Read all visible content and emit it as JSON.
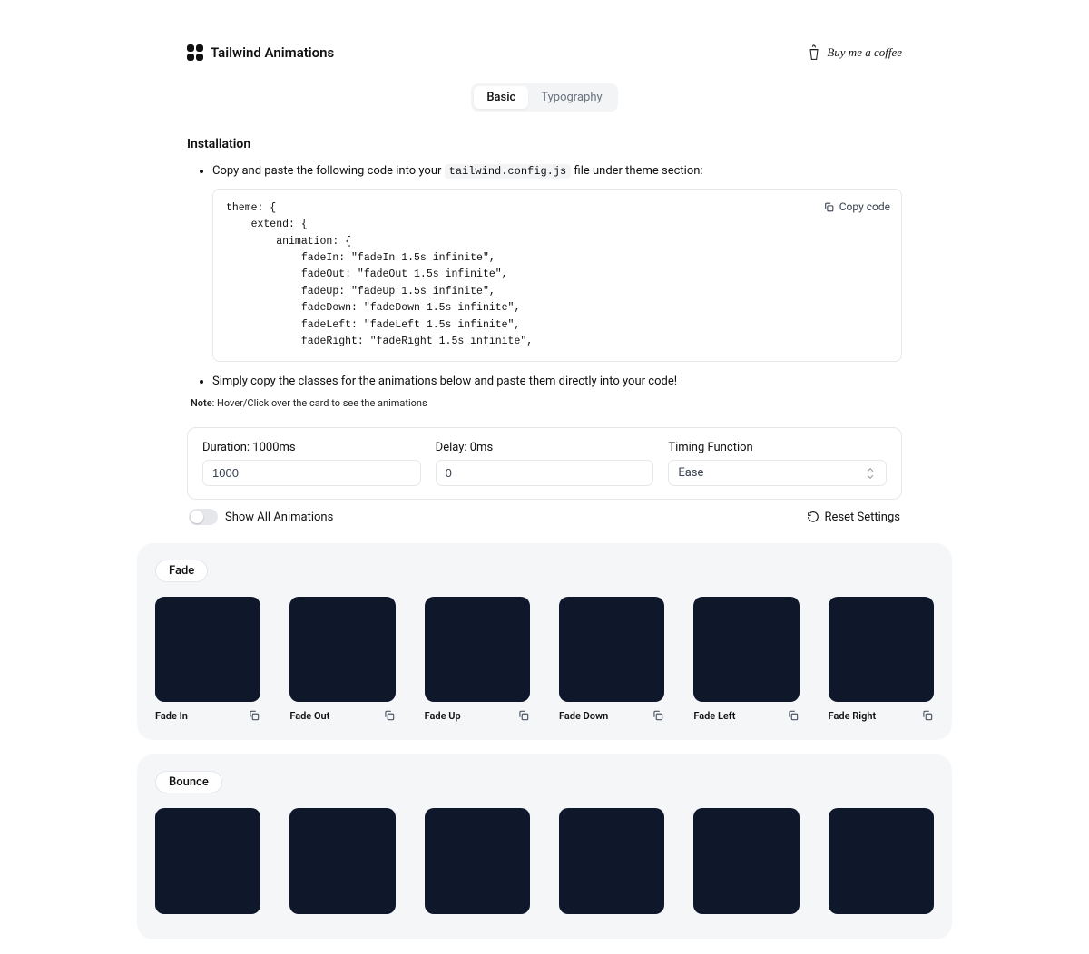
{
  "header": {
    "title": "Tailwind Animations",
    "coffee": "Buy me a coffee"
  },
  "tabs": {
    "basic": "Basic",
    "typography": "Typography"
  },
  "installation": {
    "title": "Installation",
    "step1a": "Copy and paste the following code into your ",
    "step1code": "tailwind.config.js",
    "step1b": " file under theme section:",
    "code": "theme: {\n    extend: {\n        animation: {\n            fadeIn: \"fadeIn 1.5s infinite\",\n            fadeOut: \"fadeOut 1.5s infinite\",\n            fadeUp: \"fadeUp 1.5s infinite\",\n            fadeDown: \"fadeDown 1.5s infinite\",\n            fadeLeft: \"fadeLeft 1.5s infinite\",\n            fadeRight: \"fadeRight 1.5s infinite\",",
    "copy_code": "Copy code",
    "step2": "Simply copy the classes for the animations below and paste them directly into your code!",
    "note_label": "Note",
    "note_text": ": Hover/Click over the card to see the animations"
  },
  "controls": {
    "duration_label": "Duration: 1000ms",
    "duration_value": "1000",
    "delay_label": "Delay: 0ms",
    "delay_value": "0",
    "timing_label": "Timing Function",
    "timing_value": "Ease"
  },
  "toolbar": {
    "show_all": "Show All Animations",
    "reset": "Reset Settings"
  },
  "groups": {
    "fade": {
      "title": "Fade",
      "items": [
        "Fade In",
        "Fade Out",
        "Fade Up",
        "Fade Down",
        "Fade Left",
        "Fade Right"
      ]
    },
    "bounce": {
      "title": "Bounce"
    }
  }
}
